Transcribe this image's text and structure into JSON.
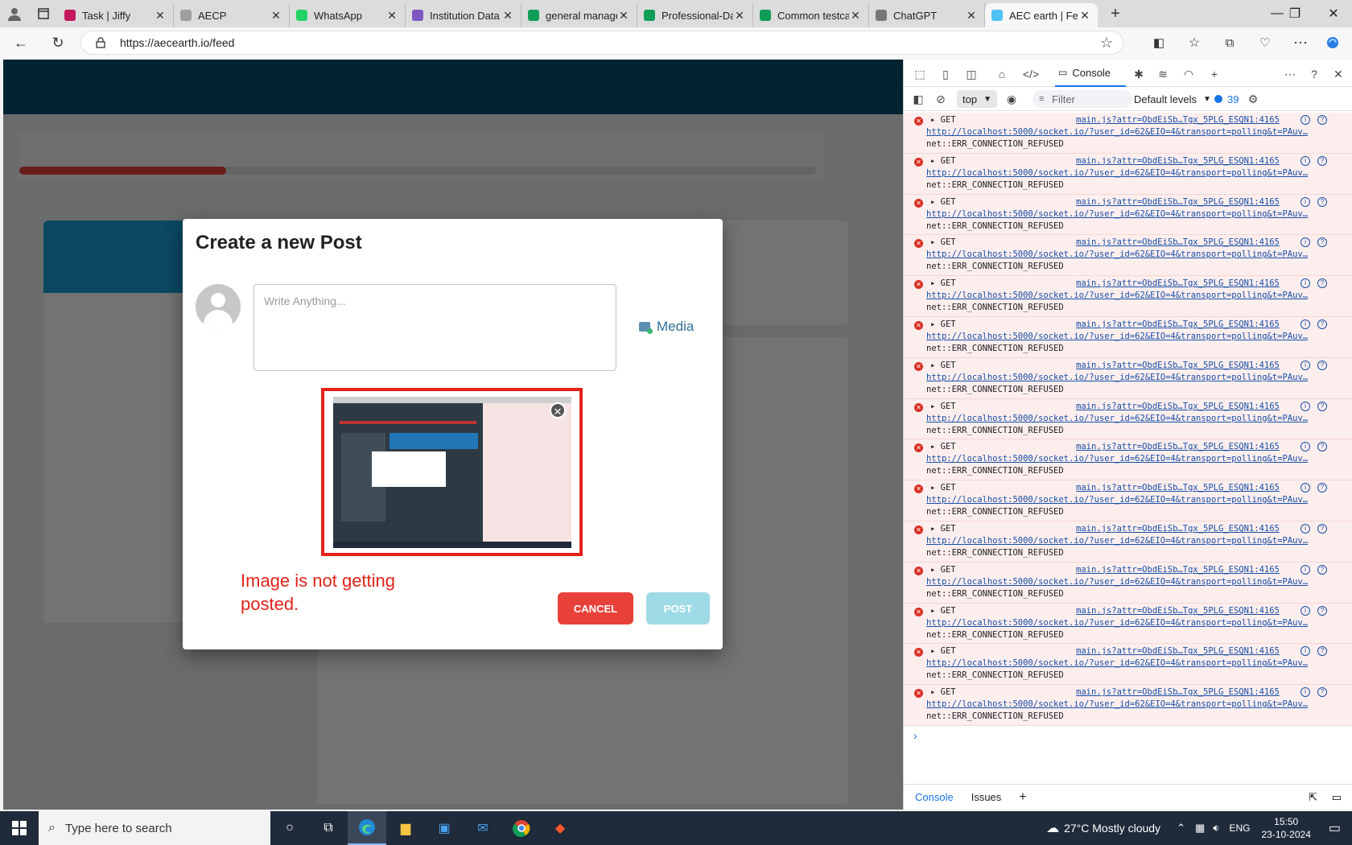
{
  "browser": {
    "tabs": [
      {
        "label": "Task | Jiffy",
        "color": "#c2185b",
        "active": false
      },
      {
        "label": "AECP",
        "color": "#9e9e9e",
        "active": false
      },
      {
        "label": "WhatsApp",
        "color": "#25d366",
        "active": false
      },
      {
        "label": "Institution Data",
        "color": "#7e57c2",
        "active": false
      },
      {
        "label": "general managem",
        "color": "#0f9d58",
        "active": false
      },
      {
        "label": "Professional-Dash",
        "color": "#0f9d58",
        "active": false
      },
      {
        "label": "Common testcase",
        "color": "#0f9d58",
        "active": false
      },
      {
        "label": "ChatGPT",
        "color": "#777777",
        "active": false
      },
      {
        "label": "AEC earth | Feed",
        "color": "#4fc3f7",
        "active": true
      }
    ],
    "url": "https://aecearth.io/feed"
  },
  "modal": {
    "title": "Create a new Post",
    "placeholder": "Write Anything...",
    "media_label": "Media",
    "annotation": "Image is not getting posted.",
    "cancel_label": "CANCEL",
    "post_label": "POST"
  },
  "devtools": {
    "active_tab": "Console",
    "context": "top",
    "filter_placeholder": "Filter",
    "levels": "Default levels",
    "message_count": "39",
    "log": [
      {
        "method": "GET",
        "source": "main.js?attr=ObdEiSb…Tgx_5PLG_ESQN1:4165",
        "url": "http://localhost:5000/socket.io/?user_id=62&EIO=4&transport=polling&t=PAuv…",
        "message": "net::ERR_CONNECTION_REFUSED"
      },
      {
        "method": "GET",
        "source": "main.js?attr=ObdEiSb…Tgx_5PLG_ESQN1:4165",
        "url": "http://localhost:5000/socket.io/?user_id=62&EIO=4&transport=polling&t=PAuv…",
        "message": "net::ERR_CONNECTION_REFUSED"
      },
      {
        "method": "GET",
        "source": "main.js?attr=ObdEiSb…Tgx_5PLG_ESQN1:4165",
        "url": "http://localhost:5000/socket.io/?user_id=62&EIO=4&transport=polling&t=PAuv…",
        "message": "net::ERR_CONNECTION_REFUSED"
      },
      {
        "method": "GET",
        "source": "main.js?attr=ObdEiSb…Tgx_5PLG_ESQN1:4165",
        "url": "http://localhost:5000/socket.io/?user_id=62&EIO=4&transport=polling&t=PAuv…",
        "message": "net::ERR_CONNECTION_REFUSED"
      },
      {
        "method": "GET",
        "source": "main.js?attr=ObdEiSb…Tgx_5PLG_ESQN1:4165",
        "url": "http://localhost:5000/socket.io/?user_id=62&EIO=4&transport=polling&t=PAuv…",
        "message": "net::ERR_CONNECTION_REFUSED"
      },
      {
        "method": "GET",
        "source": "main.js?attr=ObdEiSb…Tgx_5PLG_ESQN1:4165",
        "url": "http://localhost:5000/socket.io/?user_id=62&EIO=4&transport=polling&t=PAuv…",
        "message": "net::ERR_CONNECTION_REFUSED"
      },
      {
        "method": "GET",
        "source": "main.js?attr=ObdEiSb…Tgx_5PLG_ESQN1:4165",
        "url": "http://localhost:5000/socket.io/?user_id=62&EIO=4&transport=polling&t=PAuv…",
        "message": "net::ERR_CONNECTION_REFUSED"
      },
      {
        "method": "GET",
        "source": "main.js?attr=ObdEiSb…Tgx_5PLG_ESQN1:4165",
        "url": "http://localhost:5000/socket.io/?user_id=62&EIO=4&transport=polling&t=PAuv…",
        "message": "net::ERR_CONNECTION_REFUSED"
      },
      {
        "method": "GET",
        "source": "main.js?attr=ObdEiSb…Tgx_5PLG_ESQN1:4165",
        "url": "http://localhost:5000/socket.io/?user_id=62&EIO=4&transport=polling&t=PAuv…",
        "message": "net::ERR_CONNECTION_REFUSED"
      },
      {
        "method": "GET",
        "source": "main.js?attr=ObdEiSb…Tgx_5PLG_ESQN1:4165",
        "url": "http://localhost:5000/socket.io/?user_id=62&EIO=4&transport=polling&t=PAuv…",
        "message": "net::ERR_CONNECTION_REFUSED"
      },
      {
        "method": "GET",
        "source": "main.js?attr=ObdEiSb…Tgx_5PLG_ESQN1:4165",
        "url": "http://localhost:5000/socket.io/?user_id=62&EIO=4&transport=polling&t=PAuv…",
        "message": "net::ERR_CONNECTION_REFUSED"
      },
      {
        "method": "GET",
        "source": "main.js?attr=ObdEiSb…Tgx_5PLG_ESQN1:4165",
        "url": "http://localhost:5000/socket.io/?user_id=62&EIO=4&transport=polling&t=PAuv…",
        "message": "net::ERR_CONNECTION_REFUSED"
      },
      {
        "method": "GET",
        "source": "main.js?attr=ObdEiSb…Tgx_5PLG_ESQN1:4165",
        "url": "http://localhost:5000/socket.io/?user_id=62&EIO=4&transport=polling&t=PAuv…",
        "message": "net::ERR_CONNECTION_REFUSED"
      },
      {
        "method": "GET",
        "source": "main.js?attr=ObdEiSb…Tgx_5PLG_ESQN1:4165",
        "url": "http://localhost:5000/socket.io/?user_id=62&EIO=4&transport=polling&t=PAuv…",
        "message": "net::ERR_CONNECTION_REFUSED"
      },
      {
        "method": "GET",
        "source": "main.js?attr=ObdEiSb…Tgx_5PLG_ESQN1:4165",
        "url": "http://localhost:5000/socket.io/?user_id=62&EIO=4&transport=polling&t=PAuv…",
        "message": "net::ERR_CONNECTION_REFUSED"
      }
    ],
    "bottom_tabs": [
      "Console",
      "Issues"
    ]
  },
  "taskbar": {
    "search_placeholder": "Type here to search",
    "weather": "27°C  Mostly cloudy",
    "language": "ENG",
    "time": "15:50",
    "date": "23-10-2024"
  },
  "colors": {
    "accent_red": "#e2231a",
    "cancel_red": "#e8413a",
    "post_disabled": "#9fdbe6",
    "devtools_error_bg": "#fdeeee"
  }
}
